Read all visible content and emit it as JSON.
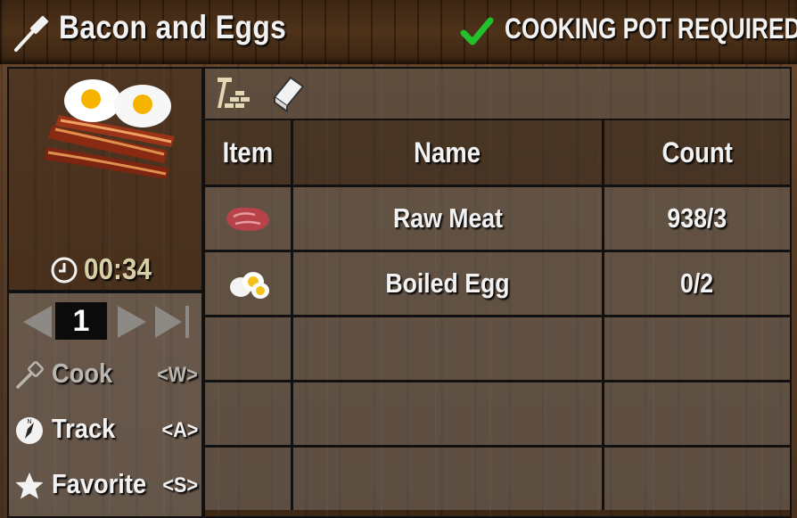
{
  "header": {
    "title": "Bacon and Eggs",
    "requirement": "COOKING POT REQUIRED",
    "requirement_met": true,
    "icons": {
      "left": "fork-icon",
      "right": "checkmark-icon"
    }
  },
  "recipe": {
    "image": "bacon-and-eggs-icon",
    "craft_time": "00:34",
    "quantity": "1"
  },
  "actions": [
    {
      "label": "Cook",
      "key": "<W>",
      "icon": "spatula-icon",
      "enabled": false
    },
    {
      "label": "Track",
      "key": "<A>",
      "icon": "compass-icon",
      "enabled": true
    },
    {
      "label": "Favorite",
      "key": "<S>",
      "icon": "star-icon",
      "enabled": true
    }
  ],
  "toolbar": {
    "icons": [
      "workstation-icon",
      "recipe-book-icon"
    ]
  },
  "ingredients": {
    "columns": [
      "Item",
      "Name",
      "Count"
    ],
    "rows": [
      {
        "icon": "raw-meat-icon",
        "name": "Raw Meat",
        "count": "938/3"
      },
      {
        "icon": "boiled-egg-icon",
        "name": "Boiled Egg",
        "count": "0/2"
      },
      {
        "icon": "",
        "name": "",
        "count": ""
      },
      {
        "icon": "",
        "name": "",
        "count": ""
      },
      {
        "icon": "",
        "name": "",
        "count": ""
      }
    ]
  },
  "colors": {
    "check": "#22c02a",
    "timer": "#d9cfa6",
    "disabled_text": "#b9b5b0"
  }
}
